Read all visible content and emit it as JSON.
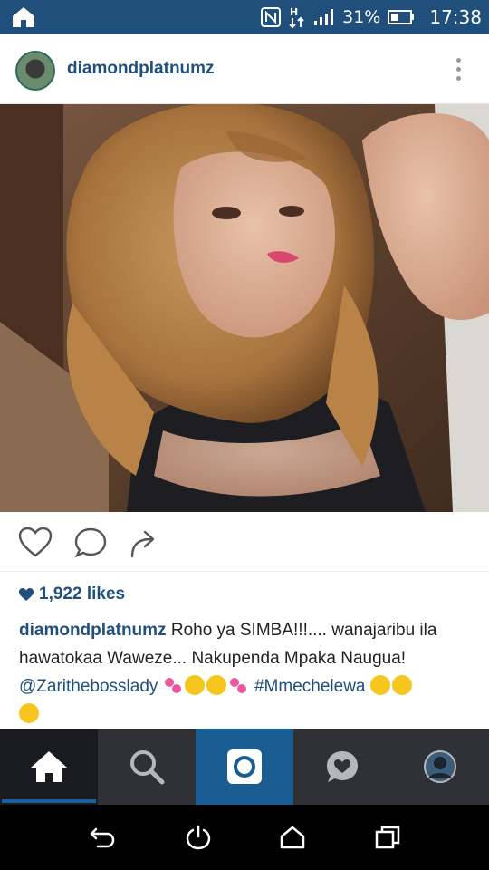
{
  "status": {
    "battery": "31%",
    "time": "17:38",
    "icons": [
      "home-icon",
      "nfc-icon",
      "data-arrows-icon",
      "signal-icon",
      "battery-icon"
    ]
  },
  "post": {
    "username": "diamondplatnumz",
    "photo_icon": "photo-image",
    "likes": "1,922 likes",
    "caption_user": "diamondplatnumz",
    "caption_text": " Roho ya SIMBA!!!.... wanajaribu ila hawatokaa Waweze... Nakupenda Mpaka Naugua! ",
    "caption_mention": "@Zarithebosslady",
    "caption_hashtag": "#Mmechelewa"
  },
  "tabs": [
    "home-icon",
    "search-icon",
    "camera-icon",
    "activity-icon",
    "profile-icon"
  ],
  "nav": [
    "back-icon",
    "power-icon",
    "home-outline-icon",
    "recents-icon"
  ],
  "colors": {
    "status_bar": "#1f4f7a",
    "link": "#1e4f7d",
    "tab_active": "#1e5f9e"
  }
}
